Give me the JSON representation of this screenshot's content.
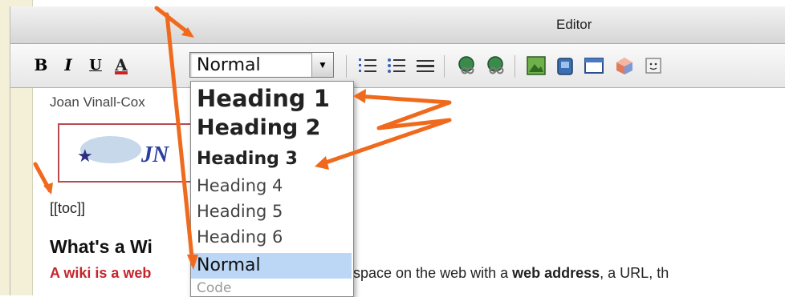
{
  "window": {
    "title": "Editor"
  },
  "toolbar": {
    "bold": "B",
    "italic": "I",
    "underline": "U",
    "text_color": "A",
    "text_color_bar": "#d02020",
    "style_select_value": "Normal",
    "icons": [
      "numbered-list-icon",
      "bulleted-list-icon",
      "horizontal-rule-icon",
      "link-icon",
      "unlink-icon",
      "image-icon",
      "file-icon",
      "table-icon",
      "widget-icon",
      "emoticon-icon"
    ]
  },
  "dropdown": {
    "options": [
      "Heading 1",
      "Heading 2",
      "Heading 3",
      "Heading 4",
      "Heading 5",
      "Heading 6",
      "Normal",
      "Code"
    ],
    "selected": "Normal",
    "highlight_color": "#bcd6f6"
  },
  "document": {
    "author": "Joan Vinall-Cox",
    "logo_text": "JN",
    "toc": "[[toc]]",
    "heading": "What's a Wi",
    "para_red": "A wiki is a web",
    "para_tail_prefix": "space on the web with a ",
    "para_tail_bold": "web address",
    "para_tail_suffix": ", a URL, th"
  },
  "annotation_color": "#f06a1e"
}
